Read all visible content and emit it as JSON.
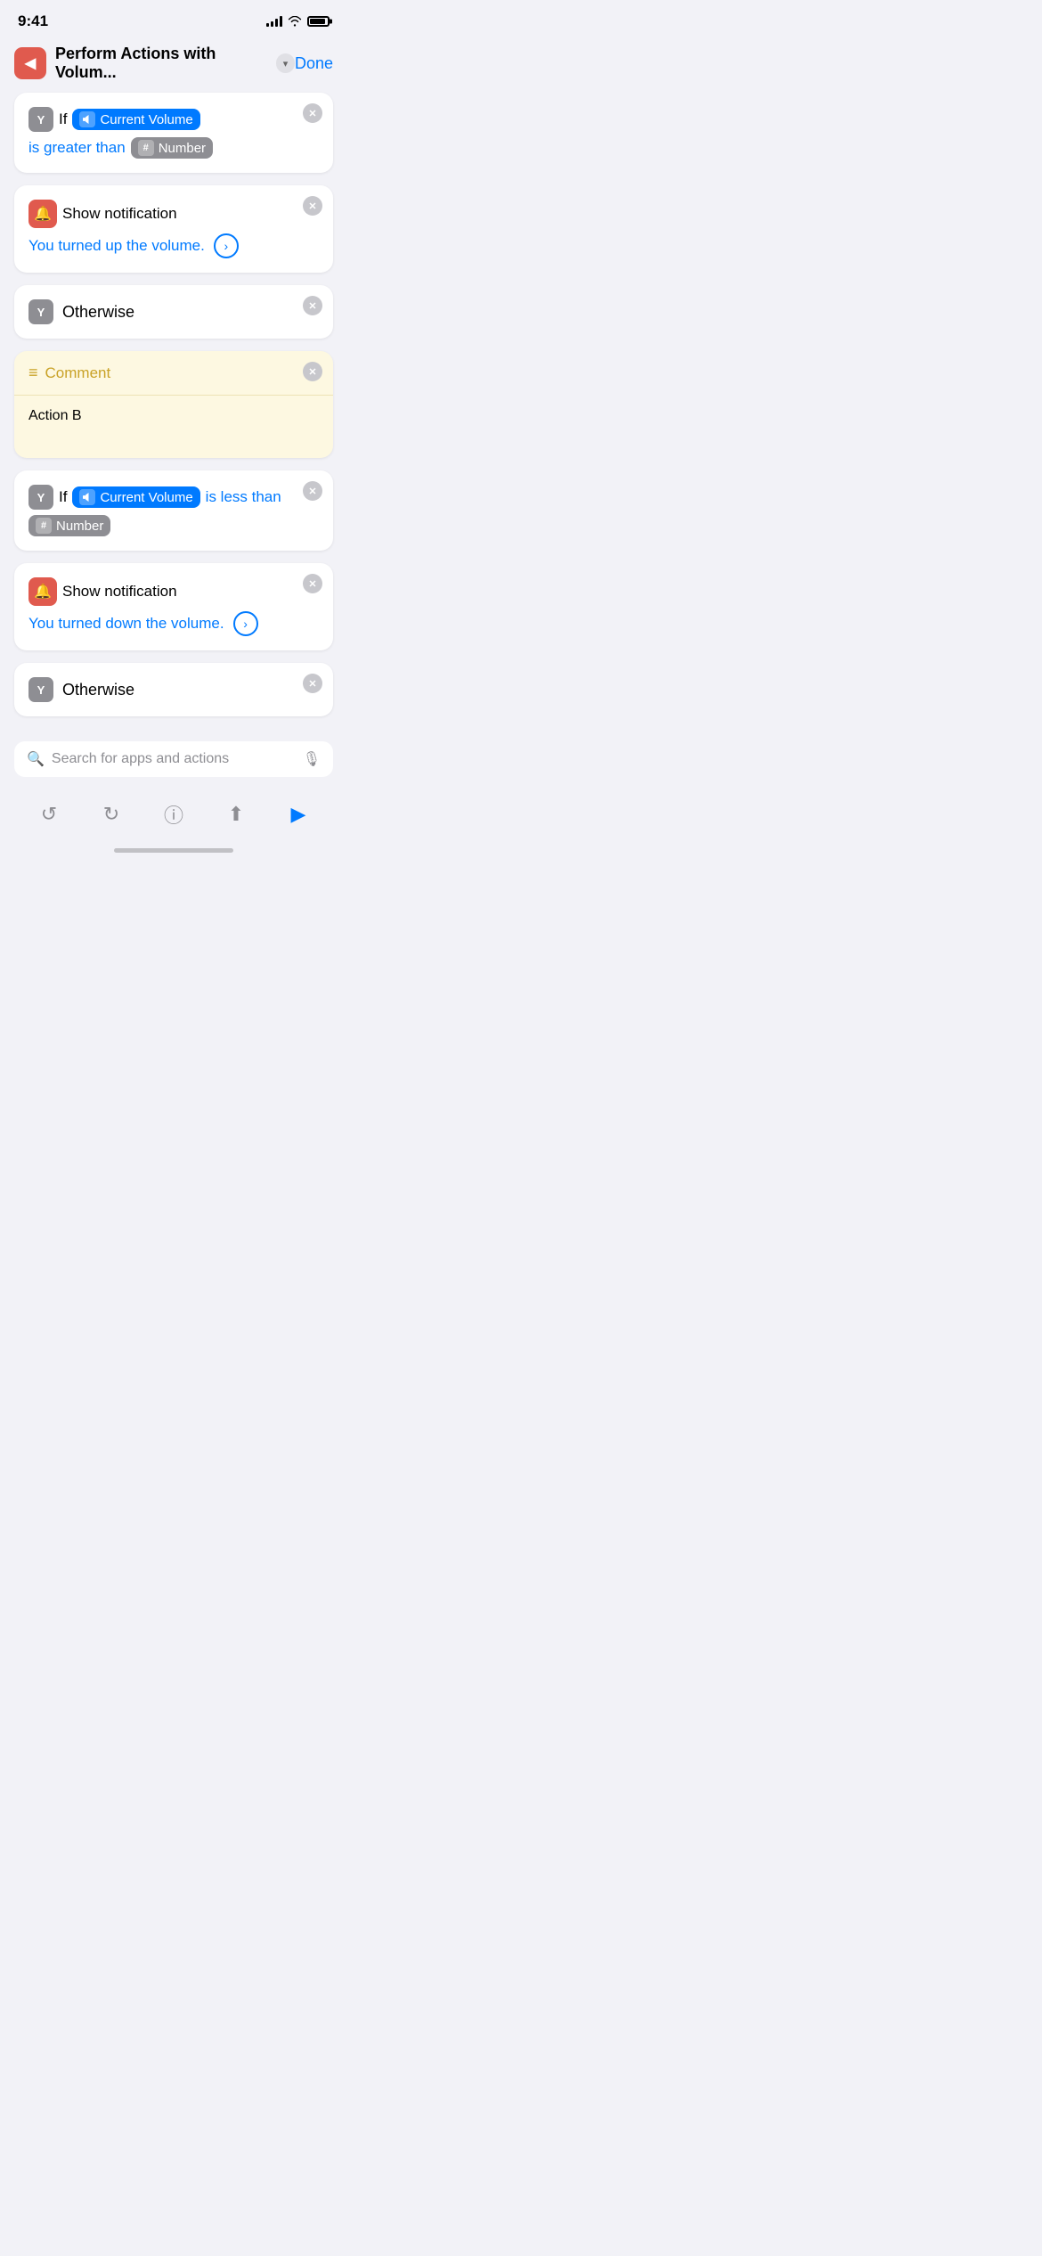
{
  "statusBar": {
    "time": "9:41",
    "battery": "full"
  },
  "navBar": {
    "backIcon": "◀",
    "title": "Perform Actions with Volum...",
    "chevronIcon": "⌄",
    "doneLabel": "Done"
  },
  "cards": [
    {
      "type": "if",
      "ifLabel": "If",
      "variableIcon": "📱",
      "variableLabel": "Current Volume",
      "conditionText": "is greater than",
      "numberLabel": "Number"
    },
    {
      "type": "notification",
      "iconEmoji": "🔔",
      "label": "Show notification",
      "value": "You turned up the volume.",
      "arrowLabel": "›"
    },
    {
      "type": "otherwise",
      "iconLabel": "Y",
      "label": "Otherwise"
    },
    {
      "type": "comment",
      "iconLabel": "☰",
      "label": "Comment",
      "body": "Action B"
    },
    {
      "type": "if",
      "ifLabel": "If",
      "variableIcon": "📱",
      "variableLabel": "Current Volume",
      "conditionText": "is less than",
      "numberLabel": "Number"
    },
    {
      "type": "notification",
      "iconEmoji": "🔔",
      "label": "Show notification",
      "value": "You turned down the volume.",
      "arrowLabel": "›"
    },
    {
      "type": "otherwise",
      "iconLabel": "Y",
      "label": "Otherwise"
    }
  ],
  "searchBar": {
    "placeholder": "Search for apps and actions",
    "searchIcon": "🔍",
    "micIcon": "🎙"
  },
  "toolbar": {
    "undoIcon": "↺",
    "redoIcon": "↻",
    "infoIcon": "ℹ",
    "shareIcon": "⬆",
    "playIcon": "▶"
  }
}
